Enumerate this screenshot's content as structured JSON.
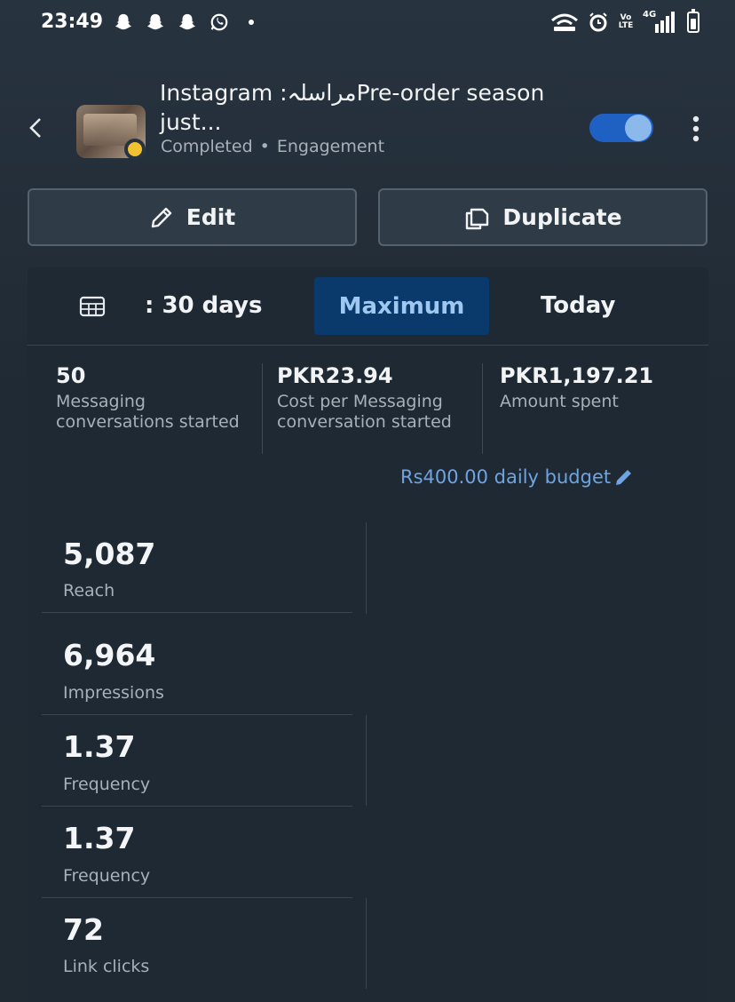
{
  "status_bar": {
    "time": "23:49",
    "left_icons": [
      "snapchat-icon",
      "snapchat-icon",
      "snapchat-icon",
      "whatsapp-icon",
      "dot-icon"
    ],
    "right_icons": [
      "hotspot-icon",
      "alarm-icon",
      "volte-icon",
      "4g-signal-icon",
      "battery-icon"
    ],
    "network_label": "4G",
    "volte_label": "Vo LTE"
  },
  "header": {
    "title": "Instagram :مراسلہPre-order season just...",
    "status": "Completed",
    "separator": "•",
    "objective": "Engagement",
    "toggle_on": true
  },
  "actions": {
    "edit_label": "Edit",
    "duplicate_label": "Duplicate"
  },
  "date_tabs": {
    "range_label": ": 30 days",
    "selected": "Maximum",
    "other": "Today"
  },
  "kpis": [
    {
      "value": "50",
      "label": "Messaging conversations started"
    },
    {
      "value": "PKR23.94",
      "label": "Cost per Messaging conversation started"
    },
    {
      "value": "PKR1,197.21",
      "label": "Amount spent"
    }
  ],
  "budget": {
    "label": "Rs400.00 daily budget"
  },
  "metrics": [
    {
      "value": "5,087",
      "label": "Reach"
    },
    {
      "value": "6,964",
      "label": "Impressions"
    },
    {
      "value": "1.37",
      "label": "Frequency"
    },
    {
      "value": "1.37",
      "label": "Frequency"
    },
    {
      "value": "72",
      "label": "Link clicks"
    }
  ],
  "colors": {
    "accent": "#1f61c2",
    "tab_selected_bg": "#0a3a6b",
    "tab_selected_text": "#9ec8f2",
    "link": "#6ea4e0",
    "status_dot": "#f2c230"
  }
}
